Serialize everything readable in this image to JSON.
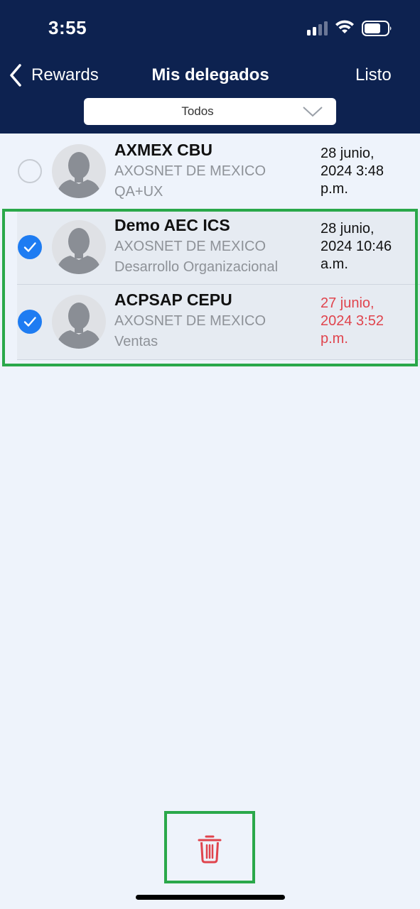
{
  "status_bar": {
    "time": "3:55"
  },
  "nav": {
    "back_label": "Rewards",
    "title": "Mis delegados",
    "done_label": "Listo"
  },
  "filter": {
    "selected": "Todos"
  },
  "delegates": [
    {
      "name": "AXMEX CBU",
      "company": "AXOSNET DE MEXICO",
      "department": "QA+UX",
      "date_line1": "28 junio,",
      "date_line2": "2024 3:48",
      "date_line3": "p.m.",
      "selected": false,
      "date_color": "#111111"
    },
    {
      "name": "Demo AEC ICS",
      "company": "AXOSNET DE MEXICO",
      "department": "Desarrollo Organizacional",
      "date_line1": "28 junio,",
      "date_line2": "2024 10:46",
      "date_line3": "a.m.",
      "selected": true,
      "date_color": "#111111"
    },
    {
      "name": "ACPSAP CEPU",
      "company": "AXOSNET DE MEXICO",
      "department": "Ventas",
      "date_line1": "27 junio,",
      "date_line2": "2024 3:52",
      "date_line3": "p.m.",
      "selected": true,
      "date_color": "#e0444d"
    }
  ],
  "colors": {
    "header_bg": "#0d2250",
    "page_bg": "#eef3fb",
    "check_blue": "#1e7cf2",
    "delete_red": "#e0444d",
    "highlight_green": "#2aa84a"
  },
  "icons": {
    "back": "chevron-left-icon",
    "dropdown": "chevron-down-icon",
    "delete": "trash-icon",
    "avatar": "person-placeholder-icon"
  }
}
